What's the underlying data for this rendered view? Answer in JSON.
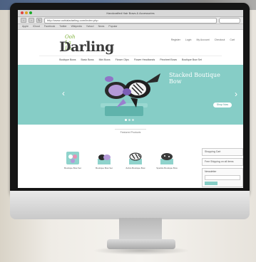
{
  "browser": {
    "window_title": "Handcrafted Hair Bows & Accessories",
    "url": "http://www.oohlaladarling.com/index.php",
    "bookmarks": [
      "Apple",
      "iCloud",
      "Facebook",
      "Twitter",
      "Wikipedia",
      "Yahoo!",
      "News",
      "Popular"
    ]
  },
  "site": {
    "logo_small": "Ooh La La",
    "logo_main": "Darling",
    "top_links": [
      "Register",
      "Login",
      "My Account",
      "Checkout",
      "Cart"
    ],
    "categories": [
      "Boutique Bows",
      "Basic Bows",
      "Mini Bows",
      "Flower Clips",
      "Flower Headbands",
      "Pinwheel Bows",
      "Boutique Bow Set"
    ],
    "hero": {
      "title": "Stacked Boutique Bow",
      "button": "Shop Now"
    },
    "featured_label": "Featured Products",
    "products": [
      {
        "label": "Boutique Bow Set",
        "icon": "bow-set-icon"
      },
      {
        "label": "Boutique Bow Set",
        "icon": "stacked-bow-icon"
      },
      {
        "label": "Zebra Boutique Bow",
        "icon": "zebra-bow-icon"
      },
      {
        "label": "Sparkle Boutique Bow",
        "icon": "sparkle-bow-icon"
      }
    ],
    "sidebar": {
      "cart_title": "Shopping Cart",
      "shipping_text": "Free Shipping on all items",
      "newsletter_title": "Newsletter"
    }
  },
  "colors": {
    "hero_bg": "#86cdc6",
    "logo_green": "#7fb13a",
    "bezel": "#151515"
  }
}
